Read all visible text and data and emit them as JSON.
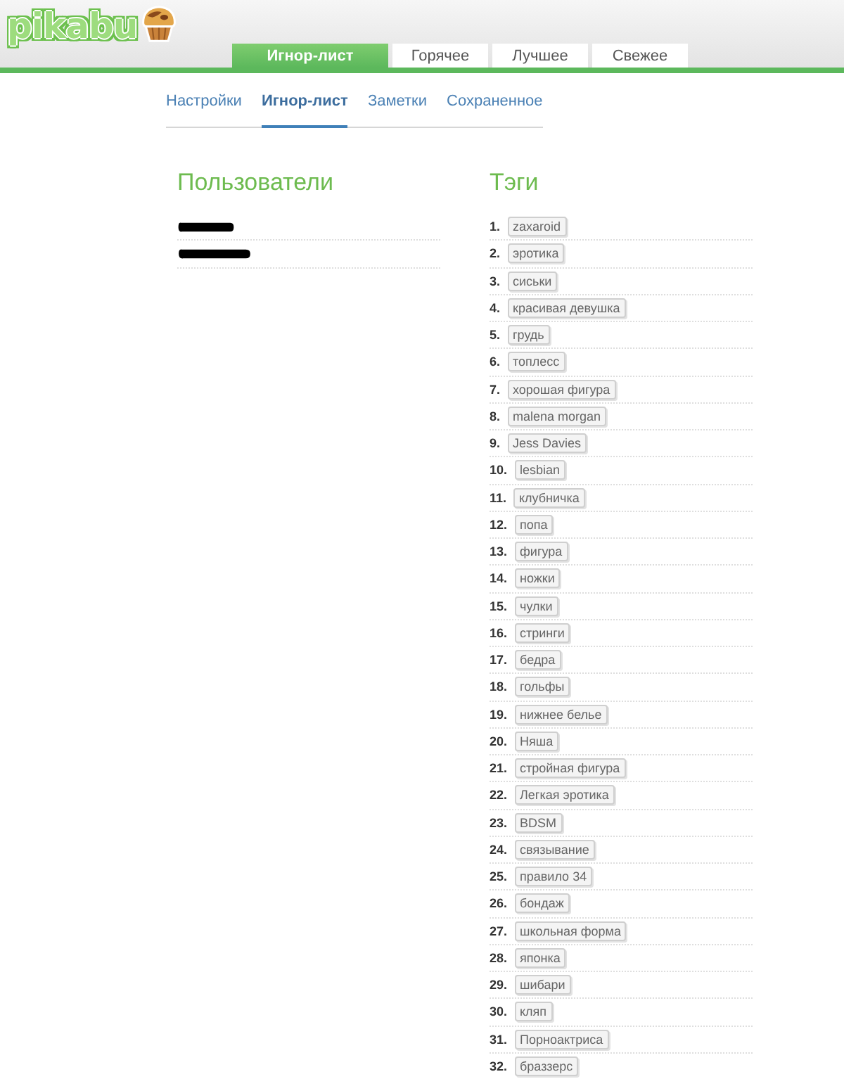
{
  "logo": {
    "text": "pikabu"
  },
  "tabs": [
    {
      "label": "Игнор-лист",
      "selected": true
    },
    {
      "label": "Горячее",
      "selected": false
    },
    {
      "label": "Лучшее",
      "selected": false
    },
    {
      "label": "Свежее",
      "selected": false
    }
  ],
  "subnav": [
    {
      "label": "Настройки",
      "selected": false
    },
    {
      "label": "Игнор-лист",
      "selected": true
    },
    {
      "label": "Заметки",
      "selected": false
    },
    {
      "label": "Сохраненное",
      "selected": false
    }
  ],
  "users": {
    "title": "Пользователи",
    "items": [
      {
        "kind": "redacted"
      },
      {
        "kind": "redacted"
      }
    ]
  },
  "tags": {
    "title": "Тэги",
    "items": [
      {
        "number": "1.",
        "label": "zaxaroid"
      },
      {
        "number": "2.",
        "label": "эротика"
      },
      {
        "number": "3.",
        "label": "сиськи"
      },
      {
        "number": "4.",
        "label": "красивая девушка"
      },
      {
        "number": "5.",
        "label": "грудь"
      },
      {
        "number": "6.",
        "label": "топлесс"
      },
      {
        "number": "7.",
        "label": "хорошая фигура"
      },
      {
        "number": "8.",
        "label": "malena morgan"
      },
      {
        "number": "9.",
        "label": "Jess Davies"
      },
      {
        "number": "10.",
        "label": "lesbian"
      },
      {
        "number": "11.",
        "label": "клубничка"
      },
      {
        "number": "12.",
        "label": "попа"
      },
      {
        "number": "13.",
        "label": "фигура"
      },
      {
        "number": "14.",
        "label": "ножки"
      },
      {
        "number": "15.",
        "label": "чулки"
      },
      {
        "number": "16.",
        "label": "стринги"
      },
      {
        "number": "17.",
        "label": "бедра"
      },
      {
        "number": "18.",
        "label": "гольфы"
      },
      {
        "number": "19.",
        "label": "нижнее белье"
      },
      {
        "number": "20.",
        "label": "Няша"
      },
      {
        "number": "21.",
        "label": "стройная фигура"
      },
      {
        "number": "22.",
        "label": "Легкая эротика"
      },
      {
        "number": "23.",
        "label": "BDSM"
      },
      {
        "number": "24.",
        "label": "связывание"
      },
      {
        "number": "25.",
        "label": "правило 34"
      },
      {
        "number": "26.",
        "label": "бондаж"
      },
      {
        "number": "27.",
        "label": "школьная форма"
      },
      {
        "number": "28.",
        "label": "японка"
      },
      {
        "number": "29.",
        "label": "шибари"
      },
      {
        "number": "30.",
        "label": "кляп"
      },
      {
        "number": "31.",
        "label": "Порноактриса"
      },
      {
        "number": "32.",
        "label": "браззерс"
      }
    ]
  }
}
